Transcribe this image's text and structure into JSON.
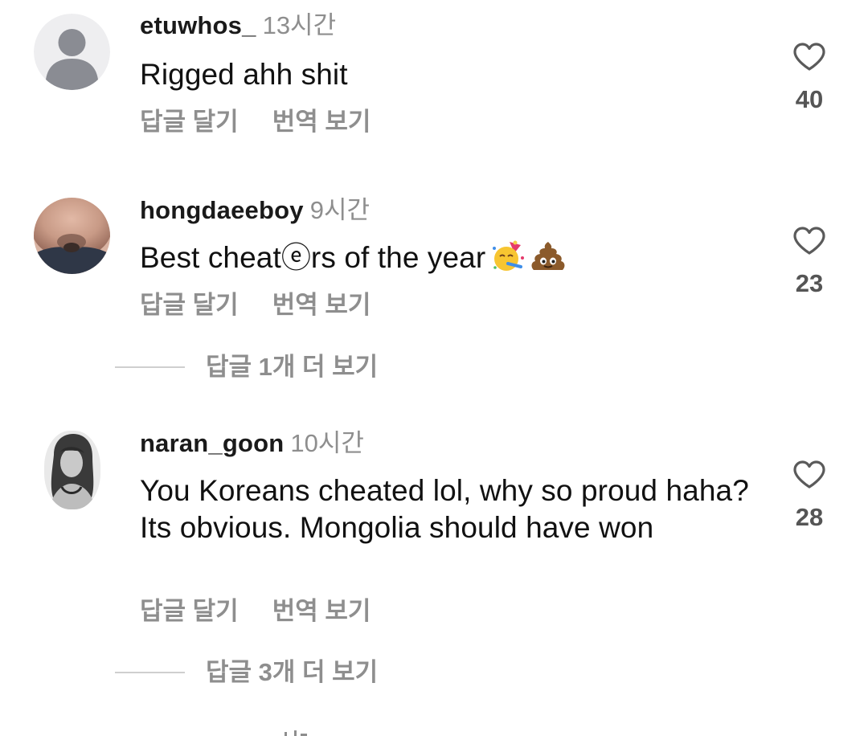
{
  "comments": [
    {
      "username": "etuwhos_",
      "time": "13시간",
      "text": "Rigged ahh shit",
      "reply_label": "답글 달기",
      "translate_label": "번역 보기",
      "likes": "40",
      "avatar": "default-avatar-icon"
    },
    {
      "username": "hongdaeeboy",
      "time": "9시간",
      "text": "Best cheatⓔrs of the year",
      "emojis": [
        "partying-face-emoji",
        "pile-of-poo-emoji"
      ],
      "reply_label": "답글 달기",
      "translate_label": "번역 보기",
      "likes": "23",
      "more_replies": "답글 1개 더 보기",
      "avatar": "photo-avatar"
    },
    {
      "username": "naran_goon",
      "time": "10시간",
      "text": "You Koreans cheated lol, why so proud haha? Its obvious. Mongolia should have won",
      "reply_label": "답글 달기",
      "translate_label": "번역 보기",
      "likes": "28",
      "more_replies": "답글 3개 더 보기",
      "avatar": "photo-avatar"
    }
  ],
  "colors": {
    "muted": "#8e8e8e",
    "text": "#111111",
    "divider": "#cfcfcf"
  }
}
